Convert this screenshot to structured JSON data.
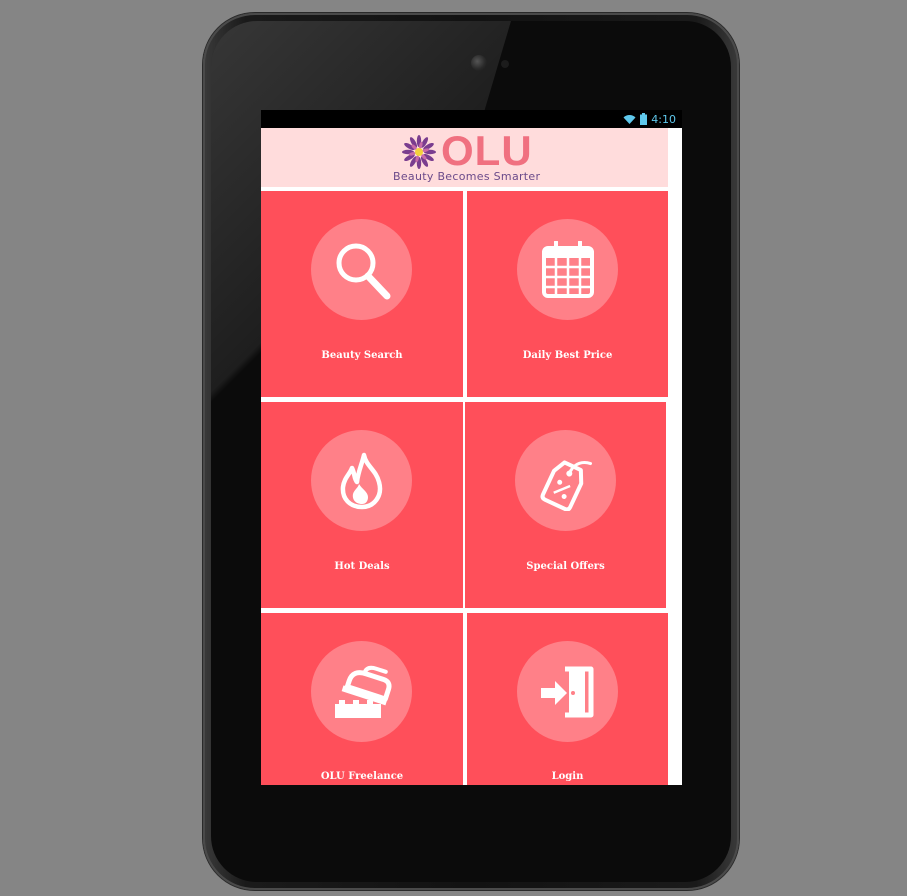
{
  "statusbar": {
    "time": "4:10",
    "wifi_icon": "wifi-icon",
    "battery_icon": "battery-icon"
  },
  "header": {
    "logo_text": "OLU",
    "tagline": "Beauty Becomes Smarter"
  },
  "tiles": [
    {
      "label": "Beauty Search",
      "icon": "search-icon"
    },
    {
      "label": "Daily Best Price",
      "icon": "calendar-icon"
    },
    {
      "label": "Hot Deals",
      "icon": "flame-icon"
    },
    {
      "label": "Special Offers",
      "icon": "percent-tag-icon"
    },
    {
      "label": "OLU Freelance",
      "icon": "iron-icon"
    },
    {
      "label": "Login",
      "icon": "login-door-icon"
    }
  ],
  "colors": {
    "tile": "#ff4f5a",
    "circle": "#ff8088",
    "header": "#ffdcdc",
    "status_accent": "#5fc8ec"
  }
}
